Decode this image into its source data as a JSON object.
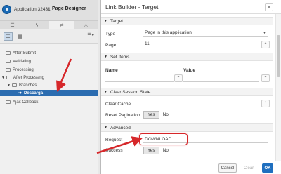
{
  "header": {
    "app_name": "Application 32431",
    "separator": "\\",
    "page_designer": "Page Designer"
  },
  "tabs": [
    {
      "icon": "layers-icon",
      "glyph": "☰"
    },
    {
      "icon": "lightning-icon",
      "glyph": "ϟ"
    },
    {
      "icon": "processing-icon",
      "glyph": "⇄"
    },
    {
      "icon": "shared-components-icon",
      "glyph": "△"
    }
  ],
  "tree": {
    "items": [
      {
        "label": "After Submit"
      },
      {
        "label": "Validating"
      },
      {
        "label": "Processing"
      },
      {
        "label": "After Processing"
      },
      {
        "label": "Branches"
      },
      {
        "label": "Descarga"
      },
      {
        "label": "Ajax Callback"
      }
    ]
  },
  "dialog": {
    "title": "Link Builder - Target",
    "close": "×",
    "sections": {
      "target": "Target",
      "set_items": "Set Items",
      "clear_session": "Clear Session State",
      "advanced": "Advanced"
    },
    "target": {
      "type_label": "Type",
      "type_value": "Page in this application",
      "page_label": "Page",
      "page_value": "11"
    },
    "set_items": {
      "name_header": "Name",
      "value_header": "Value"
    },
    "clear_session": {
      "clear_cache_label": "Clear Cache",
      "reset_pagination_label": "Reset Pagination",
      "yes": "Yes",
      "no": "No"
    },
    "advanced": {
      "request_label": "Request",
      "request_value": "DOWNLOAD",
      "success_label": "Success",
      "yes": "Yes",
      "no": "No"
    },
    "buttons": {
      "cancel": "Cancel",
      "clear": "Clear",
      "ok": "OK"
    }
  },
  "colors": {
    "accent": "#1f6fbf",
    "selection": "#2b6cb0",
    "annotation": "#d6272a"
  }
}
